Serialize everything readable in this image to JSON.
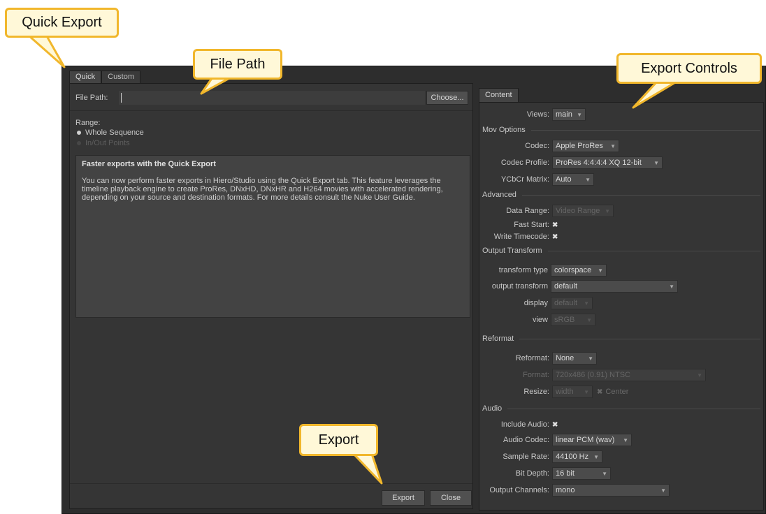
{
  "callouts": {
    "quick_export": "Quick Export",
    "file_path": "File Path",
    "export_controls": "Export Controls",
    "export": "Export"
  },
  "tabs": [
    {
      "label": "Quick",
      "active": true
    },
    {
      "label": "Custom",
      "active": false
    }
  ],
  "left": {
    "file_path_label": "File Path:",
    "file_path_value": "",
    "choose_label": "Choose...",
    "range_label": "Range:",
    "range_options": [
      {
        "label": "Whole Sequence",
        "selected": true,
        "enabled": true
      },
      {
        "label": "In/Out Points",
        "selected": false,
        "enabled": false
      }
    ],
    "info_title": "Faster exports with the Quick Export",
    "info_body": "You can now perform faster exports in Hiero/Studio using the Quick Export tab. This feature leverages the timeline playback engine to create ProRes, DNxHD, DNxHR and H264 movies with accelerated rendering, depending on your source and destination formats. For more details consult the Nuke User Guide.",
    "export_label": "Export",
    "close_label": "Close"
  },
  "right": {
    "tab_label": "Content",
    "views": {
      "label": "Views:",
      "value": "main"
    },
    "sections": {
      "mov_options": "Mov Options",
      "advanced": "Advanced",
      "output_transform": "Output Transform",
      "reformat": "Reformat",
      "audio": "Audio"
    },
    "codec": {
      "label": "Codec:",
      "value": "Apple ProRes"
    },
    "codec_profile": {
      "label": "Codec Profile:",
      "value": "ProRes 4:4:4:4 XQ 12-bit"
    },
    "ycbcr_matrix": {
      "label": "YCbCr Matrix:",
      "value": "Auto"
    },
    "data_range": {
      "label": "Data Range:",
      "value": "Video Range"
    },
    "fast_start": {
      "label": "Fast Start:",
      "checked": true
    },
    "write_timecode": {
      "label": "Write Timecode:",
      "checked": true
    },
    "transform_type": {
      "label": "transform type",
      "value": "colorspace"
    },
    "output_transform": {
      "label": "output transform",
      "value": "default"
    },
    "display": {
      "label": "display",
      "value": "default"
    },
    "view": {
      "label": "view",
      "value": "sRGB"
    },
    "reformat": {
      "label": "Reformat:",
      "value": "None"
    },
    "format": {
      "label": "Format:",
      "value": "720x486 (0.91) NTSC"
    },
    "resize": {
      "label": "Resize:",
      "value": "width",
      "center_label": "Center"
    },
    "include_audio": {
      "label": "Include Audio:",
      "checked": true
    },
    "audio_codec": {
      "label": "Audio Codec:",
      "value": "linear PCM (wav)"
    },
    "sample_rate": {
      "label": "Sample Rate:",
      "value": "44100 Hz"
    },
    "bit_depth": {
      "label": "Bit Depth:",
      "value": "16 bit"
    },
    "output_channels": {
      "label": "Output Channels:",
      "value": "mono"
    }
  },
  "icons": {
    "dropdown_arrow": "chevron-down-icon",
    "check": "x-check-icon"
  },
  "colors": {
    "callout_border": "#f1b72c",
    "callout_fill": "#fff8d8",
    "panel_bg": "#353535"
  }
}
